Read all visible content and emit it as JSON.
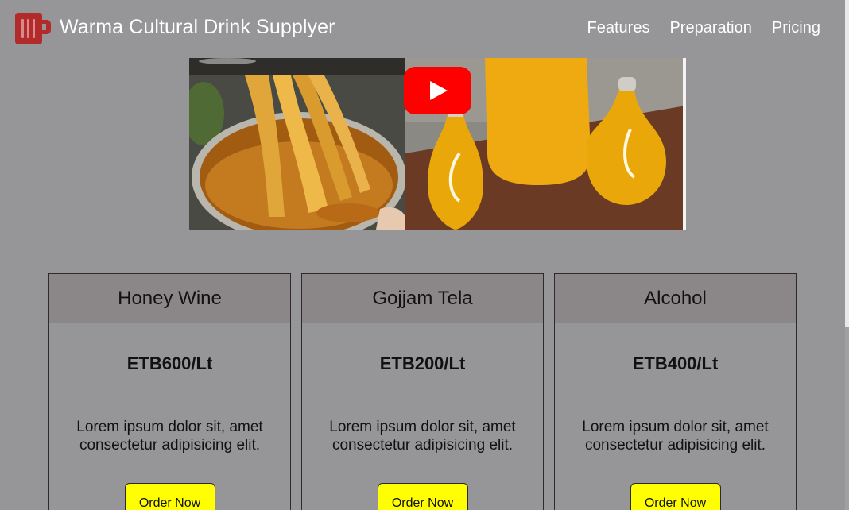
{
  "header": {
    "brand": "Warma Cultural Drink Supplyer",
    "logo_icon": "mug-icon",
    "nav": [
      {
        "label": "Features"
      },
      {
        "label": "Preparation"
      },
      {
        "label": "Pricing"
      }
    ]
  },
  "video": {
    "play_icon": "youtube-play-icon"
  },
  "pricing": [
    {
      "name": "Honey Wine",
      "price": "ETB600/Lt",
      "desc": "Lorem ipsum dolor sit, amet consectetur adipisicing elit.",
      "button": "Order Now"
    },
    {
      "name": "Gojjam Tela",
      "price": "ETB200/Lt",
      "desc": "Lorem ipsum dolor sit, amet consectetur adipisicing elit.",
      "button": "Order Now"
    },
    {
      "name": "Alcohol",
      "price": "ETB400/Lt",
      "desc": "Lorem ipsum dolor sit, amet consectetur adipisicing elit.",
      "button": "Order Now"
    }
  ],
  "colors": {
    "background": "#969597",
    "card_header": "#8b8687",
    "button": "#ffff00",
    "logo": "#b22a2a",
    "youtube": "#ff0000"
  }
}
